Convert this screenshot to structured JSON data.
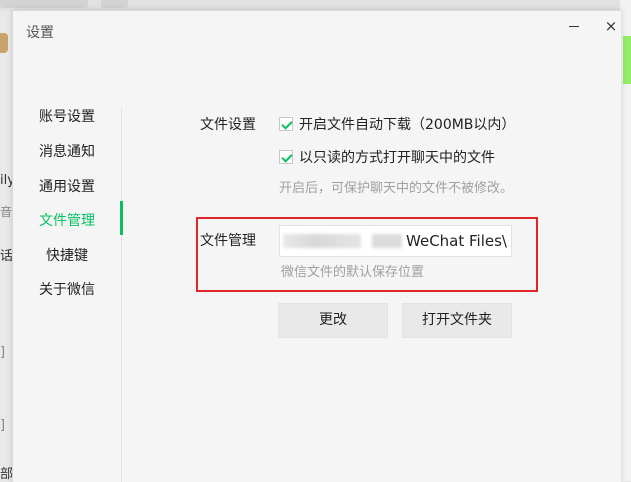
{
  "dialog": {
    "title": "设置",
    "minimize_icon": "minimize-icon",
    "close_icon": "close-icon",
    "close_glyph": "×"
  },
  "sidebar": {
    "items": [
      {
        "label": "账号设置"
      },
      {
        "label": "消息通知"
      },
      {
        "label": "通用设置"
      },
      {
        "label": "文件管理",
        "active": true
      },
      {
        "label": "快捷键"
      },
      {
        "label": "关于微信"
      }
    ]
  },
  "file_settings": {
    "label": "文件设置",
    "auto_download": {
      "label": "开启文件自动下载（200MB以内）",
      "checked": true
    },
    "read_only": {
      "label": "以只读的方式打开聊天中的文件",
      "checked": true
    },
    "read_only_hint": "开启后，可保护聊天中的文件不被修改。"
  },
  "file_management": {
    "label": "文件管理",
    "path_visible": "WeChat Files\\",
    "path_hint": "微信文件的默认保存位置",
    "change_button": "更改",
    "open_folder_button": "打开文件夹"
  },
  "background": {
    "fragments": [
      "ily",
      "音",
      "话文",
      "]",
      "]",
      "部"
    ]
  },
  "colors": {
    "accent": "#07c160",
    "highlight": "#e0262a"
  }
}
